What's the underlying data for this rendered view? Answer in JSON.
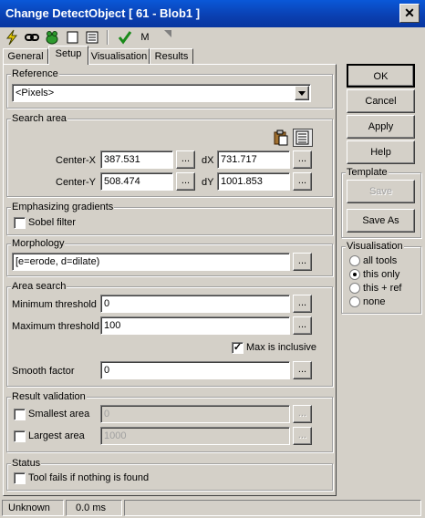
{
  "window": {
    "title": "Change DetectObject [ 61 - Blob1 ]",
    "close_glyph": "✕"
  },
  "toolbar": {
    "m_label": "M"
  },
  "tabs": [
    {
      "label": "General"
    },
    {
      "label": "Setup"
    },
    {
      "label": "Visualisation"
    },
    {
      "label": "Results"
    }
  ],
  "reference": {
    "label": "Reference",
    "value": "<Pixels>"
  },
  "search_area": {
    "label": "Search area",
    "center_x_label": "Center-X",
    "center_x": "387.531",
    "center_y_label": "Center-Y",
    "center_y": "508.474",
    "dx_label": "dX",
    "dx": "731.717",
    "dy_label": "dY",
    "dy": "1001.853"
  },
  "ellipsis": "...",
  "gradients": {
    "label": "Emphasizing gradients",
    "sobel_label": "Sobel filter",
    "sobel_checked": false
  },
  "morphology": {
    "label": "Morphology",
    "value": "[e=erode, d=dilate)"
  },
  "area_search": {
    "label": "Area search",
    "min_label": "Minimum threshold",
    "min_value": "0",
    "max_label": "Maximum threshold",
    "max_value": "100",
    "inclusive_label": "Max is inclusive",
    "inclusive_checked": true,
    "smooth_label": "Smooth factor",
    "smooth_value": "0"
  },
  "validation": {
    "label": "Result validation",
    "smallest_label": "Smallest area",
    "smallest_value": "0",
    "largest_label": "Largest area",
    "largest_value": "1000"
  },
  "status_group": {
    "label": "Status",
    "fail_label": "Tool fails if nothing is found"
  },
  "buttons": {
    "ok": "OK",
    "cancel": "Cancel",
    "apply": "Apply",
    "help": "Help"
  },
  "template": {
    "label": "Template",
    "save": "Save",
    "save_as": "Save As"
  },
  "visualisation": {
    "label": "Visualisation",
    "options": [
      "all tools",
      "this only",
      "this + ref",
      "none"
    ],
    "selected": "this only"
  },
  "statusbar": {
    "state": "Unknown",
    "time": "0.0 ms"
  },
  "colors": {
    "title_bar": "#0a3fb0",
    "face": "#d4d0c8",
    "check_green": "#1a8a1a"
  }
}
